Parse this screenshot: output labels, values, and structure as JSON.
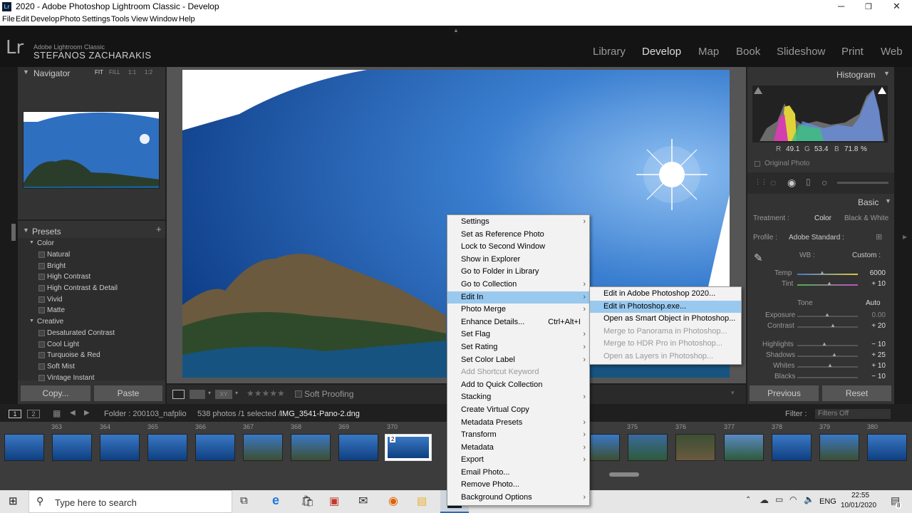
{
  "window": {
    "title": "2020 - Adobe Photoshop Lightroom Classic - Develop",
    "app_icon": "Lr"
  },
  "menubar": [
    "File",
    "Edit",
    "Develop",
    "Photo",
    "Settings",
    "Tools",
    "View",
    "Window",
    "Help"
  ],
  "identity": {
    "line1": "Adobe Lightroom Classic",
    "line2": "STEFANOS ZACHARAKIS",
    "logo": "Lr"
  },
  "modules": [
    "Library",
    "Develop",
    "Map",
    "Book",
    "Slideshow",
    "Print",
    "Web"
  ],
  "navigator": {
    "title": "Navigator",
    "zoom": [
      "FIT",
      "FILL",
      "1:1",
      "1:2"
    ]
  },
  "presets": {
    "title": "Presets",
    "groups": [
      {
        "name": "Color",
        "items": [
          "Natural",
          "Bright",
          "High Contrast",
          "High Contrast & Detail",
          "Vivid",
          "Matte"
        ]
      },
      {
        "name": "Creative",
        "items": [
          "Desaturated Contrast",
          "Cool Light",
          "Turquoise & Red",
          "Soft Mist",
          "Vintage Instant"
        ]
      }
    ]
  },
  "left_buttons": {
    "copy": "Copy...",
    "paste": "Paste"
  },
  "toolbar": {
    "soft_proofing": "Soft Proofing",
    "rating": "★★★★★",
    "compare": "XY"
  },
  "histogram": {
    "title": "Histogram",
    "r_label": "R",
    "r": "49.1",
    "g_label": "G",
    "g": "53.4",
    "b_label": "B",
    "b": "71.8",
    "unit": "%",
    "original": "Original Photo"
  },
  "basic": {
    "title": "Basic",
    "treatment_label": "Treatment :",
    "color": "Color",
    "bw": "Black & White",
    "profile_label": "Profile :",
    "profile": "Adobe Standard :",
    "wb_label": "WB :",
    "wb": "Custom :",
    "temp_label": "Temp",
    "temp": "6000",
    "tint_label": "Tint",
    "tint": "+ 10",
    "tone": "Tone",
    "auto": "Auto",
    "sliders": [
      {
        "label": "Exposure",
        "value": "0.00"
      },
      {
        "label": "Contrast",
        "value": "+ 20"
      },
      {
        "label": "Highlights",
        "value": "− 10"
      },
      {
        "label": "Shadows",
        "value": "+ 25"
      },
      {
        "label": "Whites",
        "value": "+ 10"
      },
      {
        "label": "Blacks",
        "value": "− 10"
      }
    ]
  },
  "right_buttons": {
    "previous": "Previous",
    "reset": "Reset"
  },
  "filmheader": {
    "pages": [
      "1",
      "2"
    ],
    "folder": "Folder : 200103_nafplio",
    "count": "538 photos /1 selected /",
    "file": "IMG_3541-Pano-2.dng",
    "filter_label": "Filter :",
    "filter": "Filters Off"
  },
  "filmstrip": {
    "numbers": [
      "363",
      "364",
      "365",
      "366",
      "367",
      "368",
      "369",
      "370",
      "375",
      "376",
      "377",
      "378",
      "379",
      "380"
    ],
    "stack_count": "2"
  },
  "context_menu": [
    {
      "label": "Settings",
      "sub": true
    },
    {
      "label": "Set as Reference Photo"
    },
    {
      "label": "Lock to Second Window"
    },
    {
      "label": "Show in Explorer"
    },
    {
      "label": "Go to Folder in Library"
    },
    {
      "label": "Go to Collection",
      "sub": true
    },
    {
      "label": "Edit In",
      "sub": true,
      "hl": true
    },
    {
      "label": "Photo Merge",
      "sub": true
    },
    {
      "label": "Enhance Details...",
      "shortcut": "Ctrl+Alt+I"
    },
    {
      "label": "Set Flag",
      "sub": true
    },
    {
      "label": "Set Rating",
      "sub": true
    },
    {
      "label": "Set Color Label",
      "sub": true
    },
    {
      "label": "Add Shortcut Keyword",
      "dis": true
    },
    {
      "label": "Add to Quick Collection"
    },
    {
      "label": "Stacking",
      "sub": true
    },
    {
      "label": "Create Virtual Copy"
    },
    {
      "label": "Metadata Presets",
      "sub": true
    },
    {
      "label": "Transform",
      "sub": true
    },
    {
      "label": "Metadata",
      "sub": true
    },
    {
      "label": "Export",
      "sub": true
    },
    {
      "label": "Email Photo..."
    },
    {
      "label": "Remove Photo..."
    },
    {
      "label": "Background Options",
      "sub": true
    }
  ],
  "submenu": [
    {
      "label": "Edit in Adobe Photoshop 2020..."
    },
    {
      "label": "Edit in Photoshop.exe...",
      "hl": true
    },
    {
      "label": "Open as Smart Object in Photoshop..."
    },
    {
      "label": "Merge to Panorama in Photoshop...",
      "dis": true
    },
    {
      "label": "Merge to HDR Pro in Photoshop...",
      "dis": true
    },
    {
      "label": "Open as Layers in Photoshop...",
      "dis": true
    }
  ],
  "taskbar": {
    "search": "Type here to search",
    "lang": "ENG",
    "time": "22:55",
    "date": "10/01/2020",
    "notif": "8",
    "app": "Lr"
  }
}
